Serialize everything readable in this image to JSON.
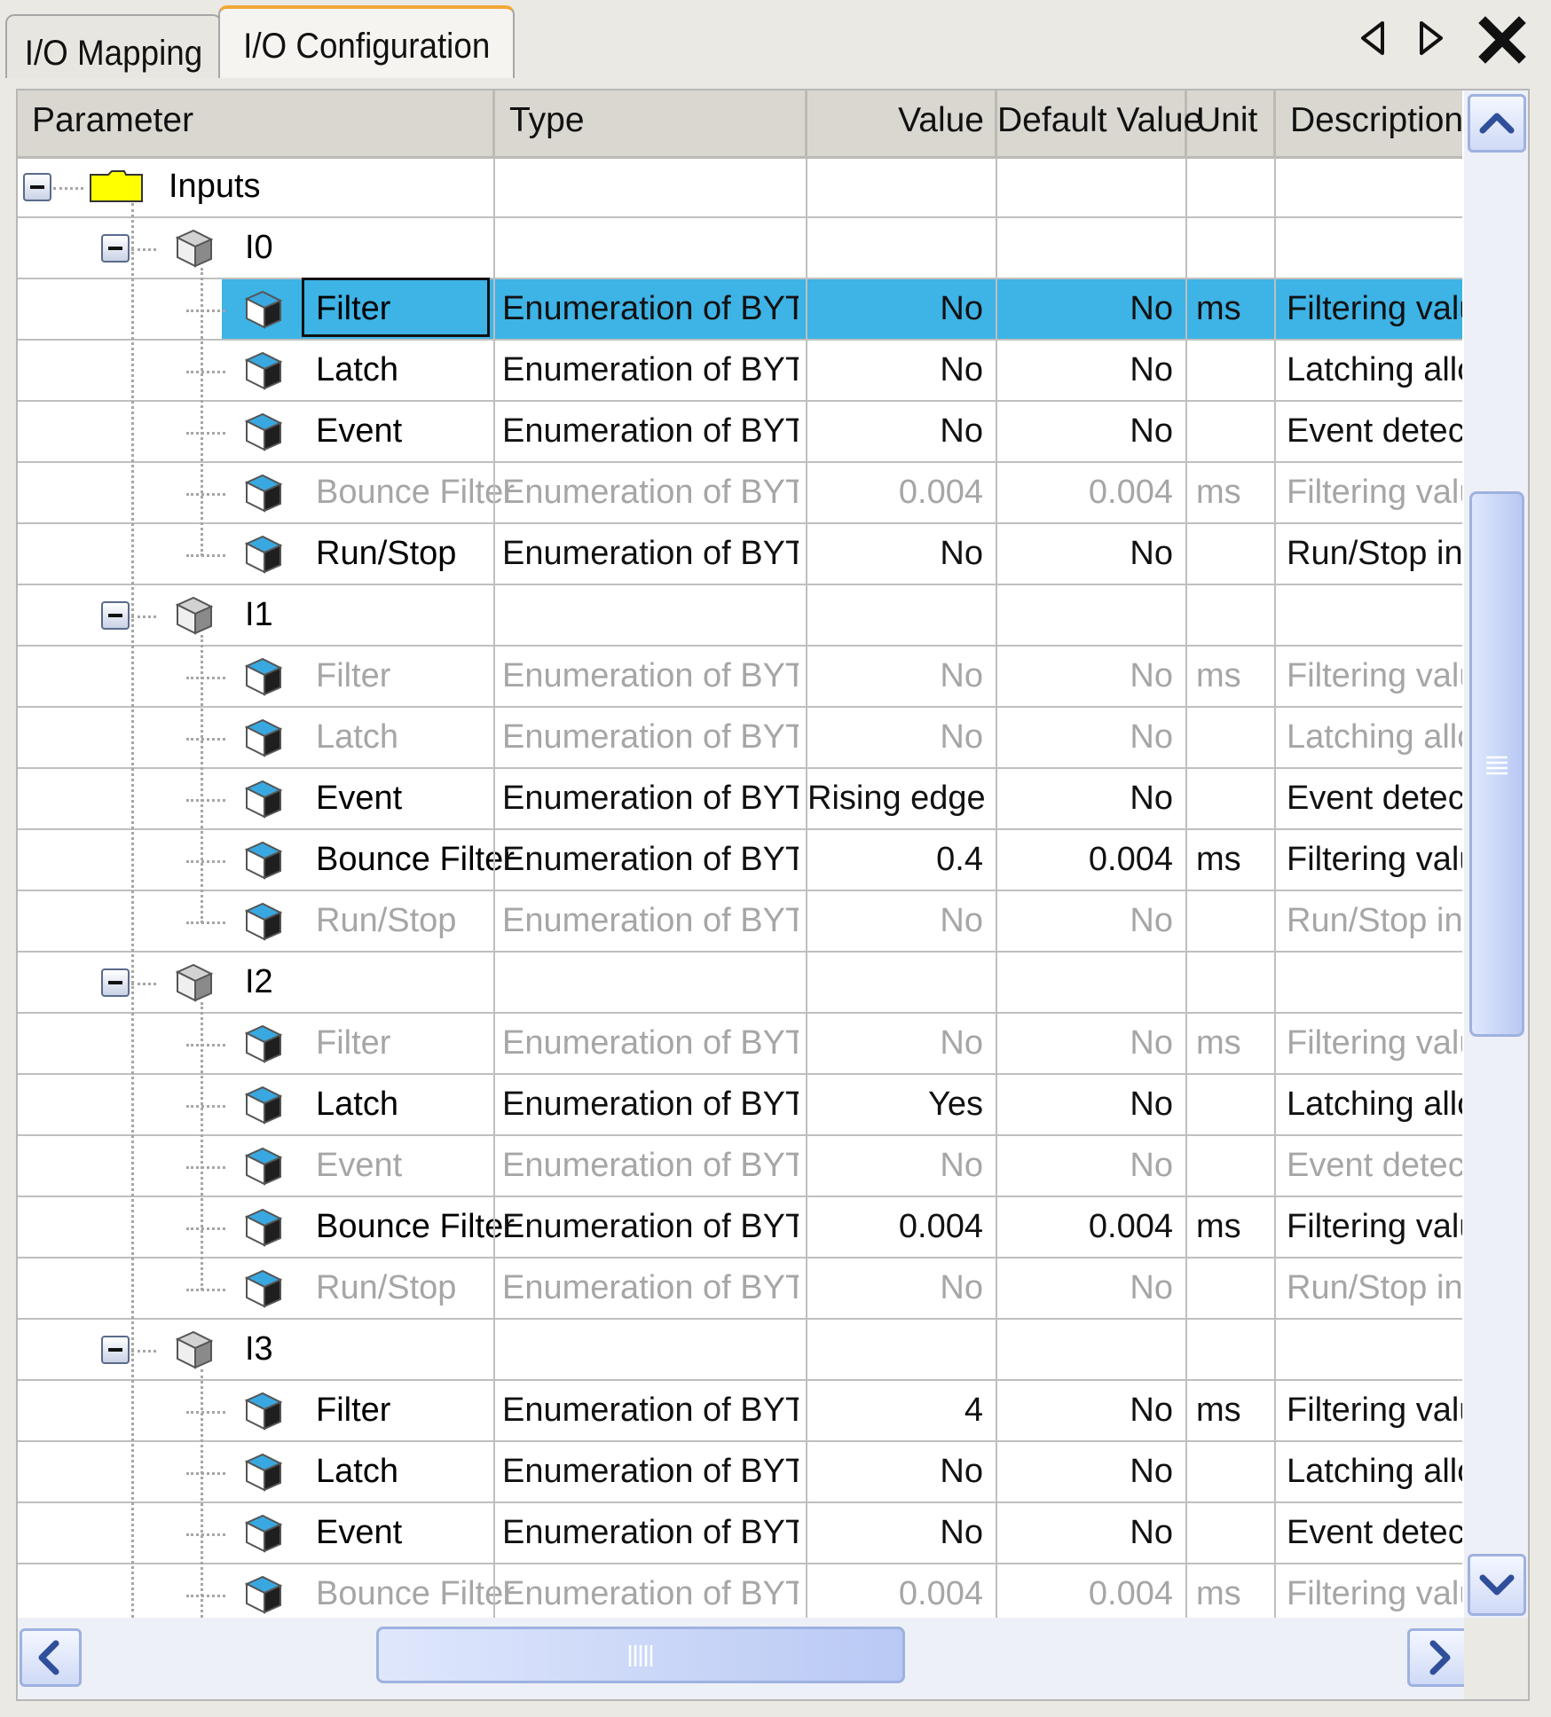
{
  "tabs": [
    {
      "label": "I/O Mapping",
      "active": false
    },
    {
      "label": "I/O Configuration",
      "active": true
    }
  ],
  "toolbar": {
    "prev_icon": "triangle-left-icon",
    "next_icon": "triangle-right-icon",
    "close_icon": "close-icon"
  },
  "columns": {
    "parameter": "Parameter",
    "type": "Type",
    "value": "Value",
    "default_value": "Default Value",
    "unit": "Unit",
    "description": "Description"
  },
  "colors": {
    "selection": "#3db3e6",
    "active_tab_accent": "#f0a838",
    "folder": "#ffff00",
    "disabled_text": "#a6a6a6"
  },
  "rows": [
    {
      "kind": "folder",
      "name": "Inputs"
    },
    {
      "kind": "channel",
      "name": "I0"
    },
    {
      "kind": "param",
      "name": "Filter",
      "type": "Enumeration of BYTE",
      "value": "No",
      "default": "No",
      "unit": "ms",
      "description": "Filtering valu",
      "enabled": true,
      "selected": true
    },
    {
      "kind": "param",
      "name": "Latch",
      "type": "Enumeration of BYTE",
      "value": "No",
      "default": "No",
      "unit": "",
      "description": "Latching allo",
      "enabled": true
    },
    {
      "kind": "param",
      "name": "Event",
      "type": "Enumeration of BYTE",
      "value": "No",
      "default": "No",
      "unit": "",
      "description": "Event detec",
      "enabled": true
    },
    {
      "kind": "param",
      "name": "Bounce Filter",
      "type": "Enumeration of BYTE",
      "value": "0.004",
      "default": "0.004",
      "unit": "ms",
      "description": "Filtering valu",
      "enabled": false
    },
    {
      "kind": "param",
      "name": "Run/Stop",
      "type": "Enumeration of BYTE",
      "value": "No",
      "default": "No",
      "unit": "",
      "description": "Run/Stop in",
      "enabled": true,
      "last": true
    },
    {
      "kind": "channel",
      "name": "I1"
    },
    {
      "kind": "param",
      "name": "Filter",
      "type": "Enumeration of BYTE",
      "value": "No",
      "default": "No",
      "unit": "ms",
      "description": "Filtering valu",
      "enabled": false
    },
    {
      "kind": "param",
      "name": "Latch",
      "type": "Enumeration of BYTE",
      "value": "No",
      "default": "No",
      "unit": "",
      "description": "Latching allo",
      "enabled": false
    },
    {
      "kind": "param",
      "name": "Event",
      "type": "Enumeration of BYTE",
      "value": "Rising edge",
      "default": "No",
      "unit": "",
      "description": "Event detec",
      "enabled": true
    },
    {
      "kind": "param",
      "name": "Bounce Filter",
      "type": "Enumeration of BYTE",
      "value": "0.4",
      "default": "0.004",
      "unit": "ms",
      "description": "Filtering valu",
      "enabled": true
    },
    {
      "kind": "param",
      "name": "Run/Stop",
      "type": "Enumeration of BYTE",
      "value": "No",
      "default": "No",
      "unit": "",
      "description": "Run/Stop in",
      "enabled": false,
      "last": true
    },
    {
      "kind": "channel",
      "name": "I2"
    },
    {
      "kind": "param",
      "name": "Filter",
      "type": "Enumeration of BYTE",
      "value": "No",
      "default": "No",
      "unit": "ms",
      "description": "Filtering valu",
      "enabled": false
    },
    {
      "kind": "param",
      "name": "Latch",
      "type": "Enumeration of BYTE",
      "value": "Yes",
      "default": "No",
      "unit": "",
      "description": "Latching allo",
      "enabled": true
    },
    {
      "kind": "param",
      "name": "Event",
      "type": "Enumeration of BYTE",
      "value": "No",
      "default": "No",
      "unit": "",
      "description": "Event detec",
      "enabled": false
    },
    {
      "kind": "param",
      "name": "Bounce Filter",
      "type": "Enumeration of BYTE",
      "value": "0.004",
      "default": "0.004",
      "unit": "ms",
      "description": "Filtering valu",
      "enabled": true
    },
    {
      "kind": "param",
      "name": "Run/Stop",
      "type": "Enumeration of BYTE",
      "value": "No",
      "default": "No",
      "unit": "",
      "description": "Run/Stop in",
      "enabled": false,
      "last": true
    },
    {
      "kind": "channel",
      "name": "I3"
    },
    {
      "kind": "param",
      "name": "Filter",
      "type": "Enumeration of BYTE",
      "value": "4",
      "default": "No",
      "unit": "ms",
      "description": "Filtering valu",
      "enabled": true
    },
    {
      "kind": "param",
      "name": "Latch",
      "type": "Enumeration of BYTE",
      "value": "No",
      "default": "No",
      "unit": "",
      "description": "Latching allo",
      "enabled": true
    },
    {
      "kind": "param",
      "name": "Event",
      "type": "Enumeration of BYTE",
      "value": "No",
      "default": "No",
      "unit": "",
      "description": "Event detec",
      "enabled": true
    },
    {
      "kind": "param",
      "name": "Bounce Filter",
      "type": "Enumeration of BYTE",
      "value": "0.004",
      "default": "0.004",
      "unit": "ms",
      "description": "Filtering valu",
      "enabled": false
    }
  ],
  "scrollbars": {
    "vertical_thumb_start": 0.24,
    "vertical_thumb_size": 0.39,
    "horizontal_thumb_start": 0.22,
    "horizontal_thumb_size": 0.4
  }
}
